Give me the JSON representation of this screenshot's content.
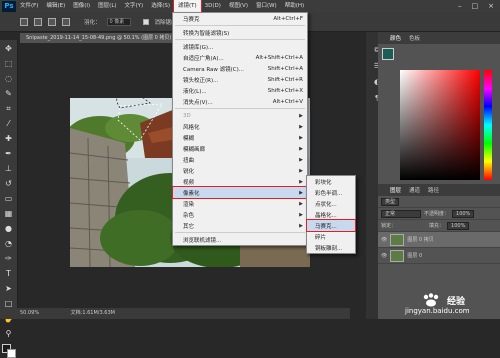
{
  "app": {
    "logo": "Ps"
  },
  "menubar": {
    "items": [
      "文件(F)",
      "编辑(E)",
      "图像(I)",
      "图层(L)",
      "文字(Y)",
      "选择(S)",
      "滤镜(T)",
      "3D(D)",
      "视图(V)",
      "窗口(W)",
      "帮助(H)"
    ],
    "active_index": 6
  },
  "options_bar": {
    "feather_label": "羽化：",
    "feather_value": "0 像素",
    "antialias_label": "消除锯齿"
  },
  "document": {
    "tab_title": "Snipaste_2019-11-14_15-08-49.png @ 50.1% (图层 0 拷贝)",
    "zoom": "50.09%",
    "doc_info": "文档:1.61M/3.63M"
  },
  "filter_menu": {
    "items": [
      {
        "label": "马赛克",
        "shortcut": "Alt+Ctrl+F",
        "disabled": false
      },
      {
        "sep": true
      },
      {
        "label": "转换为智能滤镜(S)",
        "shortcut": "",
        "disabled": false
      },
      {
        "sep": true
      },
      {
        "label": "滤镜库(G)...",
        "shortcut": "",
        "disabled": false
      },
      {
        "label": "自适应广角(A)...",
        "shortcut": "Alt+Shift+Ctrl+A",
        "disabled": false
      },
      {
        "label": "Camera Raw 滤镜(C)...",
        "shortcut": "Shift+Ctrl+A",
        "disabled": false
      },
      {
        "label": "镜头校正(R)...",
        "shortcut": "Shift+Ctrl+R",
        "disabled": false
      },
      {
        "label": "液化(L)...",
        "shortcut": "Shift+Ctrl+X",
        "disabled": false
      },
      {
        "label": "消失点(V)...",
        "shortcut": "Alt+Ctrl+V",
        "disabled": false
      },
      {
        "sep": true
      },
      {
        "label": "3D",
        "submenu": true,
        "disabled": true
      },
      {
        "label": "风格化",
        "submenu": true,
        "disabled": false
      },
      {
        "label": "模糊",
        "submenu": true,
        "disabled": false
      },
      {
        "label": "模糊画廊",
        "submenu": true,
        "disabled": false
      },
      {
        "label": "扭曲",
        "submenu": true,
        "disabled": false
      },
      {
        "label": "锐化",
        "submenu": true,
        "disabled": false
      },
      {
        "label": "视频",
        "submenu": true,
        "disabled": false
      },
      {
        "label": "像素化",
        "submenu": true,
        "disabled": false,
        "active": true
      },
      {
        "label": "渲染",
        "submenu": true,
        "disabled": false
      },
      {
        "label": "杂色",
        "submenu": true,
        "disabled": false
      },
      {
        "label": "其它",
        "submenu": true,
        "disabled": false
      },
      {
        "sep": true
      },
      {
        "label": "浏览联机滤镜...",
        "shortcut": "",
        "disabled": false
      }
    ]
  },
  "pixelate_submenu": {
    "items": [
      {
        "label": "彩块化",
        "highlighted": false
      },
      {
        "label": "彩色半调...",
        "highlighted": false
      },
      {
        "label": "点状化...",
        "highlighted": false
      },
      {
        "label": "晶格化...",
        "highlighted": false
      },
      {
        "label": "马赛克...",
        "highlighted": true
      },
      {
        "label": "碎片",
        "highlighted": false
      },
      {
        "label": "铜板雕刻...",
        "highlighted": false
      }
    ]
  },
  "color_panel": {
    "tabs": [
      "颜色",
      "色板"
    ]
  },
  "layers_panel": {
    "tabs": [
      "图层",
      "通道",
      "路径"
    ],
    "kind_filter": "类型",
    "blend_mode": "正常",
    "opacity_label": "不透明度：",
    "opacity_value": "100%",
    "lock_label": "锁定：",
    "fill_label": "填充：",
    "fill_value": "100%",
    "layers": [
      {
        "name": "图层 0 拷贝",
        "selected": true
      },
      {
        "name": "图层 0",
        "selected": false
      }
    ]
  },
  "watermark": {
    "brand": "经验",
    "url": "jingyan.baidu.com"
  },
  "colors": {
    "accent_red": "#e02020",
    "menu_bg": "#f0f0f0",
    "ui_dark": "#3a3a3a"
  }
}
